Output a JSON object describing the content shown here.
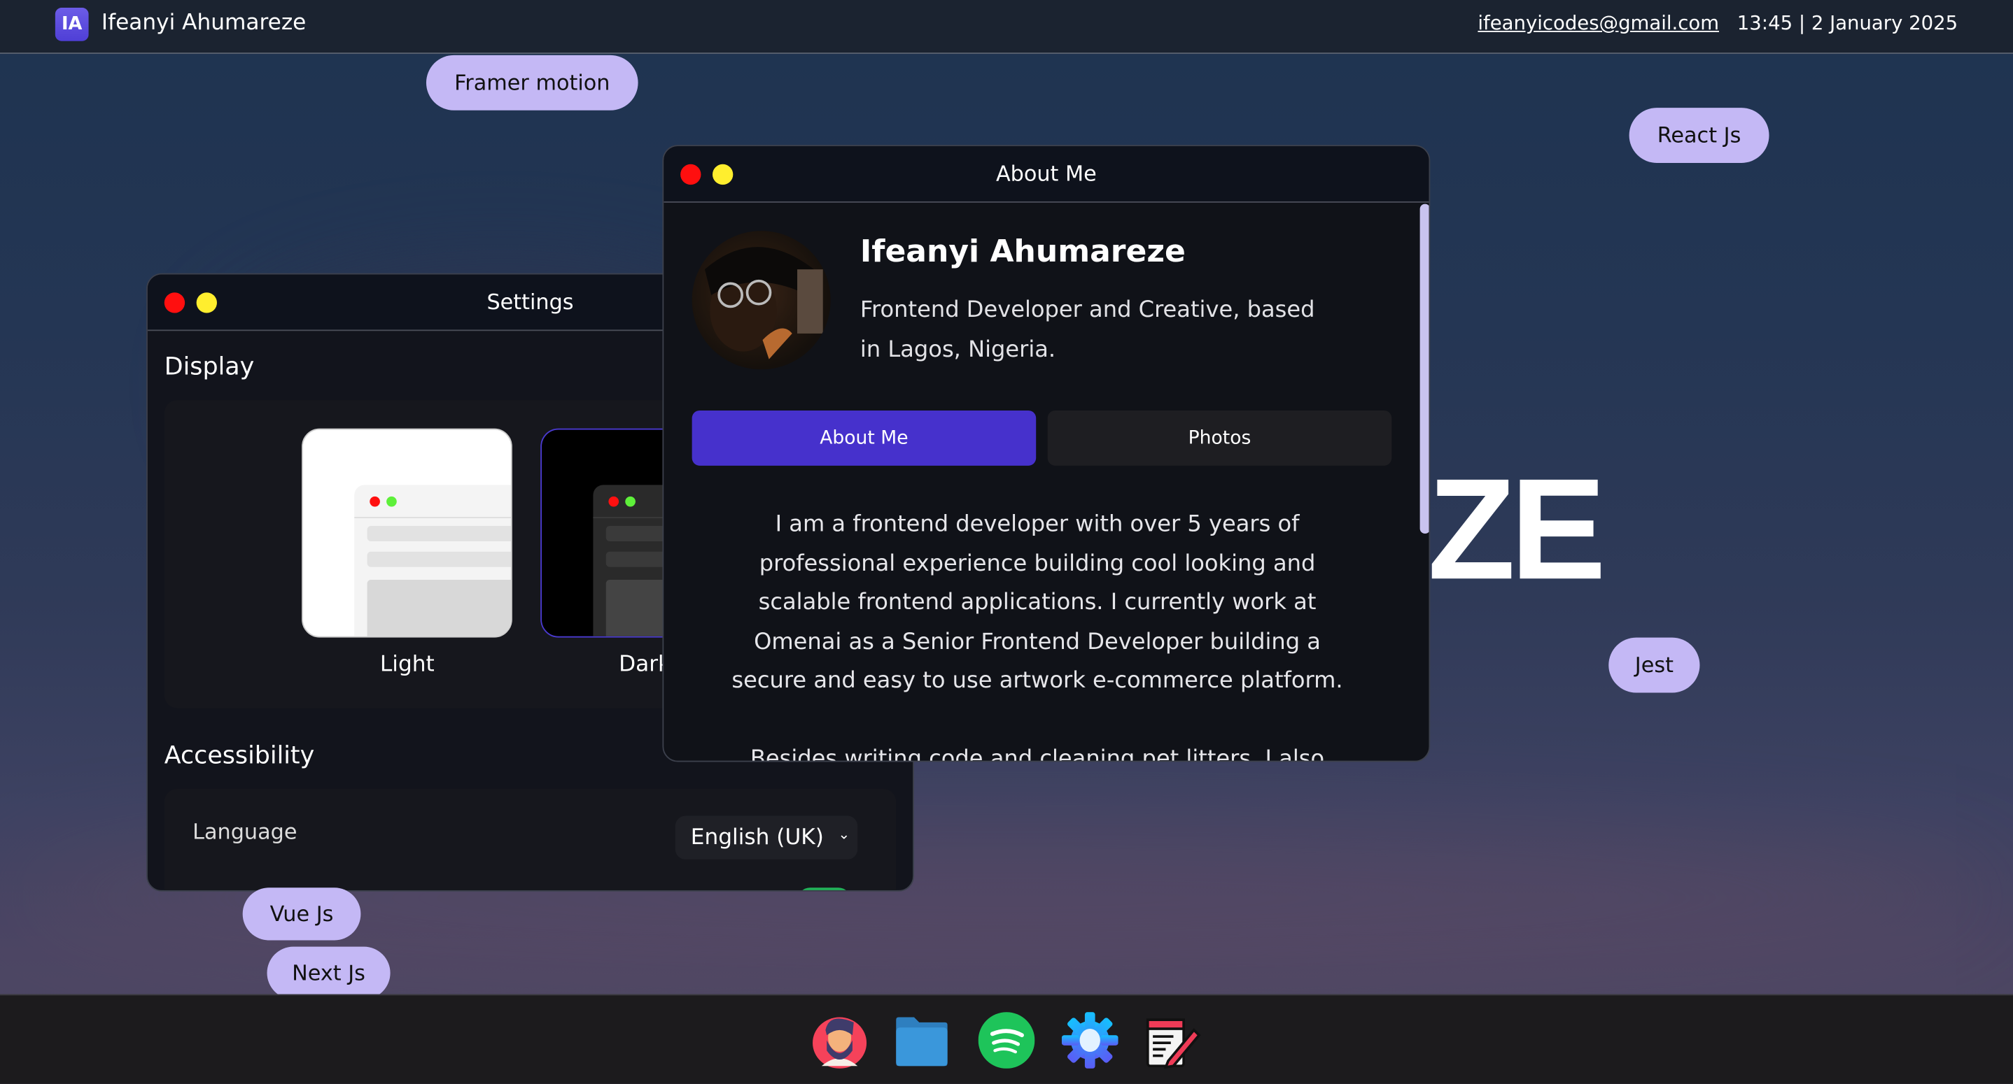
{
  "topbar": {
    "logo_initials": "IA",
    "brand": "Ifeanyi Ahumareze",
    "email": "ifeanyicodes@gmail.com",
    "datetime": "13:45 | 2 January 2025"
  },
  "tags": [
    "Framer motion",
    "React Js",
    "Jest",
    "Vue Js",
    "Next Js"
  ],
  "background_text": "ZE",
  "settings": {
    "title": "Settings",
    "display_heading": "Display",
    "themes": [
      {
        "label": "Light",
        "selected": false
      },
      {
        "label": "Dark",
        "selected": true
      }
    ],
    "accessibility_heading": "Accessibility",
    "language_label": "Language",
    "language_value": "English (UK)"
  },
  "about": {
    "title": "About Me",
    "name": "Ifeanyi Ahumareze",
    "subtitle_lines": [
      "Frontend Developer and Creative, based",
      "in Lagos, Nigeria."
    ],
    "tabs": [
      {
        "label": "About Me",
        "active": true
      },
      {
        "label": "Photos",
        "active": false
      }
    ],
    "paragraph_lines": [
      "I am a frontend developer with over 5 years of",
      "professional experience building cool looking and",
      "scalable frontend applications. I currently work at",
      "Omenai as a Senior Frontend Developer building a",
      "secure and easy to use artwork e-commerce platform."
    ],
    "next_paragraph_partial": "Besides writing code and cleaning pet litters, I also"
  },
  "dock": [
    "avatar-app",
    "files-folder",
    "spotify",
    "settings",
    "notes"
  ],
  "colors": {
    "accent": "#4631cc",
    "tag": "#c4b8f5",
    "close": "#ff0f0f",
    "minimize": "#ffee2e"
  }
}
